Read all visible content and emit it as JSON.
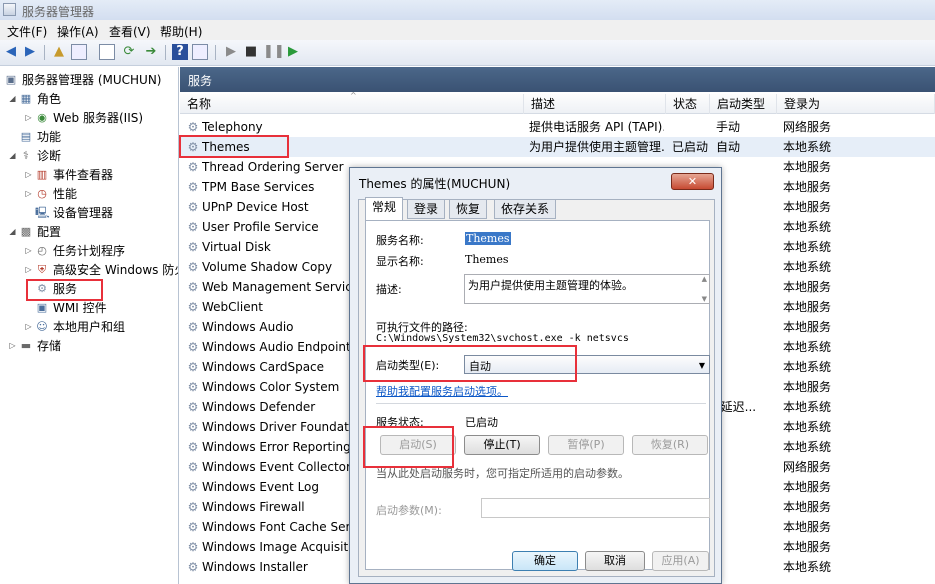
{
  "window": {
    "title": "服务器管理器"
  },
  "menu": [
    "文件(F)",
    "操作(A)",
    "查看(V)",
    "帮助(H)"
  ],
  "tree": [
    {
      "label": "服务器管理器 (MUCHUN)",
      "icon": "server-manager-icon",
      "level": 0,
      "expander": ""
    },
    {
      "label": "角色",
      "icon": "roles-icon",
      "level": 1,
      "expander": "◢"
    },
    {
      "label": "Web 服务器(IIS)",
      "icon": "web-server-icon",
      "level": 2,
      "expander": "▷"
    },
    {
      "label": "功能",
      "icon": "features-icon",
      "level": 1,
      "expander": ""
    },
    {
      "label": "诊断",
      "icon": "diagnostics-icon",
      "level": 1,
      "expander": "◢"
    },
    {
      "label": "事件查看器",
      "icon": "event-viewer-icon",
      "level": 2,
      "expander": "▷"
    },
    {
      "label": "性能",
      "icon": "performance-icon",
      "level": 2,
      "expander": "▷"
    },
    {
      "label": "设备管理器",
      "icon": "device-manager-icon",
      "level": 2,
      "expander": ""
    },
    {
      "label": "配置",
      "icon": "configuration-icon",
      "level": 1,
      "expander": "◢"
    },
    {
      "label": "任务计划程序",
      "icon": "task-scheduler-icon",
      "level": 2,
      "expander": "▷"
    },
    {
      "label": "高级安全 Windows 防火墙",
      "icon": "firewall-icon",
      "level": 2,
      "expander": "▷"
    },
    {
      "label": "服务",
      "icon": "services-icon",
      "level": 2,
      "expander": ""
    },
    {
      "label": "WMI 控件",
      "icon": "wmi-icon",
      "level": 2,
      "expander": ""
    },
    {
      "label": "本地用户和组",
      "icon": "users-groups-icon",
      "level": 2,
      "expander": "▷"
    },
    {
      "label": "存储",
      "icon": "storage-icon",
      "level": 1,
      "expander": "▷"
    }
  ],
  "pane": {
    "title": "服务"
  },
  "columns": {
    "name": "名称",
    "desc": "描述",
    "status": "状态",
    "startup": "启动类型",
    "logon": "登录为"
  },
  "services": [
    {
      "name": "Telephony",
      "desc": "提供电话服务 API (TAPI)...",
      "status": "",
      "startup": "手动",
      "logon": "网络服务"
    },
    {
      "name": "Themes",
      "desc": "为用户提供使用主题管理...",
      "status": "已启动",
      "startup": "自动",
      "logon": "本地系统"
    },
    {
      "name": "Thread Ordering Server",
      "desc": "",
      "status": "",
      "startup": "",
      "logon": "本地服务"
    },
    {
      "name": "TPM Base Services",
      "desc": "",
      "status": "",
      "startup": "",
      "logon": "本地服务"
    },
    {
      "name": "UPnP Device Host",
      "desc": "",
      "status": "",
      "startup": "",
      "logon": "本地服务"
    },
    {
      "name": "User Profile Service",
      "desc": "",
      "status": "",
      "startup": "",
      "logon": "本地系统"
    },
    {
      "name": "Virtual Disk",
      "desc": "",
      "status": "",
      "startup": "",
      "logon": "本地系统"
    },
    {
      "name": "Volume Shadow Copy",
      "desc": "",
      "status": "",
      "startup": "",
      "logon": "本地系统"
    },
    {
      "name": "Web Management Service",
      "desc": "",
      "status": "",
      "startup": "",
      "logon": "本地服务"
    },
    {
      "name": "WebClient",
      "desc": "",
      "status": "",
      "startup": "",
      "logon": "本地服务"
    },
    {
      "name": "Windows Audio",
      "desc": "",
      "status": "",
      "startup": "",
      "logon": "本地服务"
    },
    {
      "name": "Windows Audio Endpoint B",
      "desc": "",
      "status": "",
      "startup": "",
      "logon": "本地系统"
    },
    {
      "name": "Windows CardSpace",
      "desc": "",
      "status": "",
      "startup": "",
      "logon": "本地系统"
    },
    {
      "name": "Windows Color System",
      "desc": "",
      "status": "",
      "startup": "",
      "logon": "本地服务"
    },
    {
      "name": "Windows Defender",
      "desc": "",
      "status": "",
      "startup": "(延迟...",
      "logon": "本地系统"
    },
    {
      "name": "Windows Driver Foundation",
      "desc": "",
      "status": "",
      "startup": "",
      "logon": "本地系统"
    },
    {
      "name": "Windows Error Reporting",
      "desc": "",
      "status": "",
      "startup": "",
      "logon": "本地系统"
    },
    {
      "name": "Windows Event Collector",
      "desc": "",
      "status": "",
      "startup": "",
      "logon": "网络服务"
    },
    {
      "name": "Windows Event Log",
      "desc": "",
      "status": "",
      "startup": "",
      "logon": "本地服务"
    },
    {
      "name": "Windows Firewall",
      "desc": "",
      "status": "",
      "startup": "",
      "logon": "本地服务"
    },
    {
      "name": "Windows Font Cache Servic",
      "desc": "",
      "status": "",
      "startup": "",
      "logon": "本地服务"
    },
    {
      "name": "Windows Image Acquisition",
      "desc": "",
      "status": "",
      "startup": "",
      "logon": "本地服务"
    },
    {
      "name": "Windows Installer",
      "desc": "",
      "status": "",
      "startup": "",
      "logon": "本地系统"
    }
  ],
  "dialog": {
    "title": "Themes 的属性(MUCHUN)",
    "tabs": [
      "常规",
      "登录",
      "恢复",
      "依存关系"
    ],
    "service_name_label": "服务名称:",
    "service_name": "Themes",
    "display_name_label": "显示名称:",
    "display_name": "Themes",
    "description_label": "描述:",
    "description": "为用户提供使用主题管理的体验。",
    "path_label": "可执行文件的路径:",
    "path": "C:\\Windows\\System32\\svchost.exe -k netsvcs",
    "startup_type_label": "启动类型(E):",
    "startup_type": "自动",
    "help_link": "帮助我配置服务启动选项。",
    "status_label": "服务状态:",
    "status": "已启动",
    "btn_start": "启动(S)",
    "btn_stop": "停止(T)",
    "btn_pause": "暂停(P)",
    "btn_resume": "恢复(R)",
    "hint": "当从此处启动服务时，您可指定所适用的启动参数。",
    "params_label": "启动参数(M):",
    "btn_ok": "确定",
    "btn_cancel": "取消",
    "btn_apply": "应用(A)"
  },
  "colors": {
    "highlight": "#e8303a",
    "pane_header": "#3a5273",
    "link": "#0b57c7"
  }
}
